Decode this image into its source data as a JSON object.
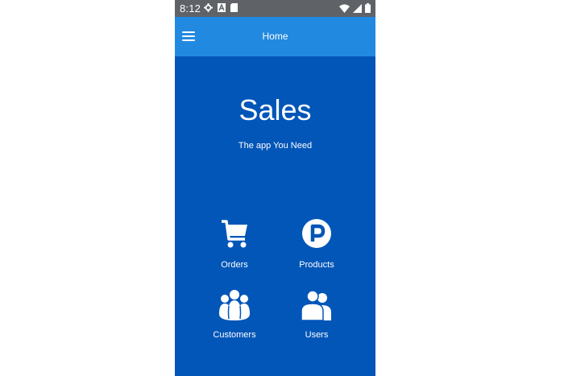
{
  "status_bar": {
    "time": "8:12",
    "left_icons": [
      "settings-icon",
      "a-icon",
      "sd-card-icon"
    ],
    "right_icons": [
      "wifi-icon",
      "signal-icon",
      "battery-icon"
    ]
  },
  "app_bar": {
    "title": "Home",
    "menu_icon": "hamburger-menu-icon"
  },
  "hero": {
    "title": "Sales",
    "subtitle": "The app You Need"
  },
  "tiles": [
    {
      "label": "Orders",
      "icon": "shopping-cart-icon"
    },
    {
      "label": "Products",
      "icon": "parking-p-icon"
    },
    {
      "label": "Customers",
      "icon": "group-icon"
    },
    {
      "label": "Users",
      "icon": "users-icon"
    }
  ],
  "colors": {
    "background": "#0256b8",
    "app_bar": "#2289e0",
    "status_bar": "#5f6368",
    "text": "#ffffff"
  }
}
